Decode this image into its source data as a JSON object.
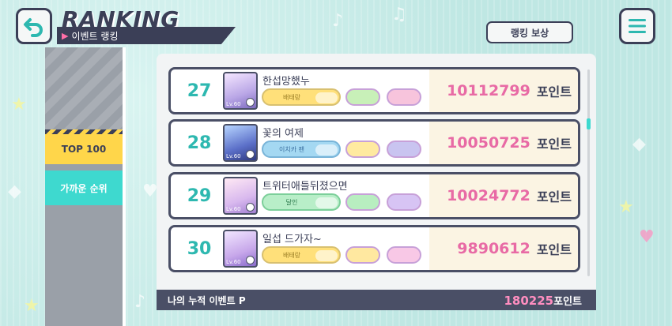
{
  "header": {
    "title": "RANKING",
    "subtitle": "이벤트 랭킹",
    "rewards_label": "랭킹 보상"
  },
  "tabs": [
    {
      "label": "TOP 100",
      "selected": true
    },
    {
      "label": "가까운 순위",
      "selected": false
    }
  ],
  "rows": [
    {
      "rank": "27",
      "name": "한섭망했누",
      "avatar_level": "Lv.60",
      "title_badge": "배태랑",
      "points": "10112799",
      "unit": "포인트",
      "title_style": "yellow"
    },
    {
      "rank": "28",
      "name": "꽃의 여제",
      "avatar_level": "Lv.60",
      "title_badge": "이치카 팬",
      "points": "10050725",
      "unit": "포인트",
      "title_style": "blue"
    },
    {
      "rank": "29",
      "name": "트위터애들뒤졌으면",
      "avatar_level": "Lv.60",
      "title_badge": "달인",
      "points": "10024772",
      "unit": "포인트",
      "title_style": "green"
    },
    {
      "rank": "30",
      "name": "일섭 드가자~",
      "avatar_level": "Lv.60",
      "title_badge": "배태랑",
      "points": "9890612",
      "unit": "포인트",
      "title_style": "yellow"
    }
  ],
  "footer": {
    "label": "나의 누적 이벤트 P",
    "value": "180225",
    "unit": "포인트"
  },
  "colors": {
    "accent": "#3ed9cf",
    "rank_text": "#2eb8b0",
    "points_text": "#e86aa5",
    "dark": "#3b3f57",
    "tab_selected": "#ffd64a"
  },
  "icons": [
    "back-arrow-icon",
    "menu-icon"
  ]
}
